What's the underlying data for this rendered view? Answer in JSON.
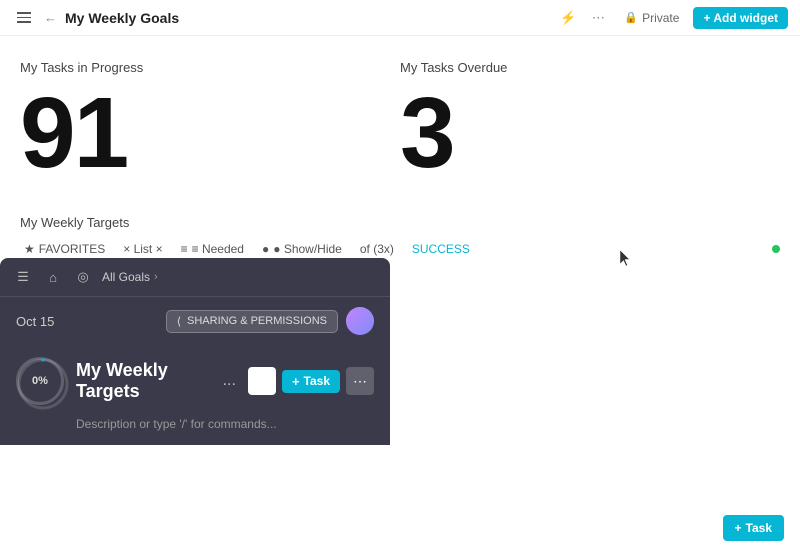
{
  "header": {
    "title": "My Weekly Goals",
    "back_label": "←",
    "private_label": "Private",
    "add_widget_label": "+ Add widget"
  },
  "stats": [
    {
      "label": "My Tasks in Progress",
      "value": "91"
    },
    {
      "label": "My Tasks Overdue",
      "value": "3"
    }
  ],
  "weekly_targets": {
    "section_label": "My Weekly Targets",
    "filters": [
      {
        "label": "FAVORITES",
        "icon": "★"
      },
      {
        "label": "× List ×",
        "icon": ""
      },
      {
        "label": "≡ Needed",
        "icon": ""
      },
      {
        "label": "● Show/Hide",
        "icon": ""
      },
      {
        "label": "of (3x)",
        "icon": ""
      },
      {
        "label": "SUCCESS",
        "icon": ""
      }
    ]
  },
  "overlay": {
    "breadcrumb": "All Goals",
    "date": "Oct 15",
    "sharing_label": "SHARING & PERMISSIONS",
    "goal_title": "My Weekly Targets",
    "progress_percent": "0%",
    "dots": "...",
    "add_task_label": "+ Task",
    "description_placeholder": "Description or type '/' for commands...",
    "bottom_task_label": "+ Task"
  },
  "icons": {
    "hamburger": "☰",
    "back": "←",
    "lock": "🔒",
    "share": "⟨",
    "more_vert": "⋯",
    "dots_three": "...",
    "chevron_right": "›",
    "target": "◎",
    "home": "⌂",
    "plus": "+",
    "expand": "⤢"
  }
}
